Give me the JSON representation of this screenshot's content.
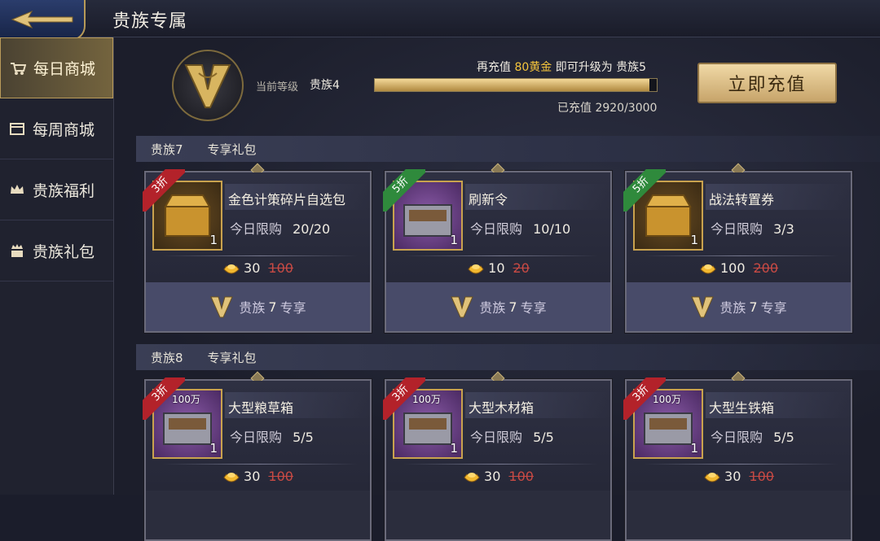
{
  "header": {
    "title": "贵族专属"
  },
  "sidebar": {
    "items": [
      {
        "label": "每日商城",
        "icon": "cart-icon",
        "active": true
      },
      {
        "label": "每周商城",
        "icon": "calendar-icon",
        "active": false
      },
      {
        "label": "贵族福利",
        "icon": "crown-icon",
        "active": false
      },
      {
        "label": "贵族礼包",
        "icon": "gift-crown-icon",
        "active": false
      }
    ]
  },
  "vip": {
    "level_label": "当前等级",
    "level_value": "贵族4",
    "upgrade_prefix": "再充值",
    "upgrade_amount": "80黄金",
    "upgrade_middle": "即可升级为",
    "upgrade_target": "贵族5",
    "charged_text": "已充值 2920/3000",
    "progress": 0.973,
    "recharge_label": "立即充值"
  },
  "sections": [
    {
      "vip": "贵族7",
      "title": "专享礼包"
    },
    {
      "vip": "贵族8",
      "title": "专享礼包"
    }
  ],
  "cards": [
    {
      "discount": "3折",
      "tag_color": "red",
      "name": "金色计策碎片自选包",
      "limit_label": "今日限购",
      "limit": "20/20",
      "qty": "1",
      "price": "30",
      "old_price": "100",
      "badge_prefix": "贵族",
      "badge_level": "7",
      "badge_suffix": "专享",
      "thumb": "gold"
    },
    {
      "discount": "5折",
      "tag_color": "green",
      "name": "刷新令",
      "limit_label": "今日限购",
      "limit": "10/10",
      "qty": "1",
      "price": "10",
      "old_price": "20",
      "badge_prefix": "贵族",
      "badge_level": "7",
      "badge_suffix": "专享",
      "thumb": "purple"
    },
    {
      "discount": "5折",
      "tag_color": "green",
      "name": "战法转置券",
      "limit_label": "今日限购",
      "limit": "3/3",
      "qty": "1",
      "price": "100",
      "old_price": "200",
      "badge_prefix": "贵族",
      "badge_level": "7",
      "badge_suffix": "专享",
      "thumb": "gold"
    },
    {
      "discount": "3折",
      "tag_color": "red",
      "name": "大型粮草箱",
      "limit_label": "今日限购",
      "limit": "5/5",
      "qty": "1",
      "mini": "100万",
      "price": "30",
      "old_price": "100",
      "thumb": "purple"
    },
    {
      "discount": "3折",
      "tag_color": "red",
      "name": "大型木材箱",
      "limit_label": "今日限购",
      "limit": "5/5",
      "qty": "1",
      "mini": "100万",
      "price": "30",
      "old_price": "100",
      "thumb": "purple"
    },
    {
      "discount": "3折",
      "tag_color": "red",
      "name": "大型生铁箱",
      "limit_label": "今日限购",
      "limit": "5/5",
      "qty": "1",
      "mini": "100万",
      "price": "30",
      "old_price": "100",
      "thumb": "purple"
    }
  ],
  "colors": {
    "gold": "#f5c53c",
    "old_price": "#c84a44",
    "accent": "#b99b5a"
  }
}
